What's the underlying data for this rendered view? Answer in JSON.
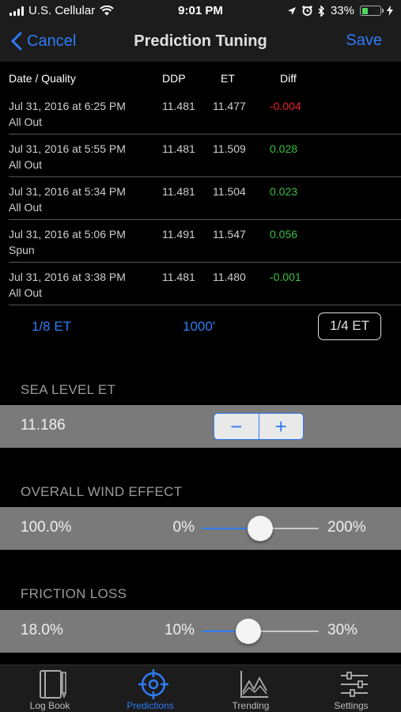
{
  "status_bar": {
    "carrier": "U.S. Cellular",
    "time": "9:01 PM",
    "battery": "33%",
    "battery_level": 0.33,
    "icons": [
      "signal-icon",
      "wifi-icon",
      "location-arrow-icon",
      "alarm-icon",
      "bluetooth-icon",
      "battery-icon",
      "charging-icon"
    ]
  },
  "nav": {
    "back_label": "Cancel",
    "title": "Prediction Tuning",
    "save_label": "Save",
    "accent_color": "#2f7cf6"
  },
  "table": {
    "headers": {
      "date": "Date / Quality",
      "ddp": "DDP",
      "et": "ET",
      "diff": "Diff"
    },
    "rows": [
      {
        "date": "Jul 31, 2016 at 6:25 PM",
        "quality": "All Out",
        "ddp": "11.481",
        "et": "11.477",
        "diff": "-0.004",
        "diff_sign": "neg"
      },
      {
        "date": "Jul 31, 2016 at 5:55 PM",
        "quality": "All Out",
        "ddp": "11.481",
        "et": "11.509",
        "diff": "0.028",
        "diff_sign": "pos"
      },
      {
        "date": "Jul 31, 2016 at 5:34 PM",
        "quality": "All Out",
        "ddp": "11.481",
        "et": "11.504",
        "diff": "0.023",
        "diff_sign": "pos"
      },
      {
        "date": "Jul 31, 2016 at 5:06 PM",
        "quality": "Spun",
        "ddp": "11.491",
        "et": "11.547",
        "diff": "0.056",
        "diff_sign": "pos"
      },
      {
        "date": "Jul 31, 2016 at 3:38 PM",
        "quality": "All Out",
        "ddp": "11.481",
        "et": "11.480",
        "diff": "-0.001",
        "diff_sign": "pos"
      }
    ],
    "negative_color": "#e8242b",
    "positive_color": "#36c13e"
  },
  "distance_selector": {
    "options": [
      "1/8 ET",
      "1000'",
      "1/4 ET"
    ],
    "selected": "1/4 ET"
  },
  "sea_level_et": {
    "header": "SEA LEVEL ET",
    "value": "11.186",
    "minus": "−",
    "plus": "+"
  },
  "wind_effect": {
    "header": "OVERALL WIND EFFECT",
    "value": "100.0%",
    "min_label": "0%",
    "max_label": "200%",
    "level": 0.5
  },
  "friction_loss": {
    "header": "FRICTION LOSS",
    "value": "18.0%",
    "min_label": "10%",
    "max_label": "30%",
    "level": 0.4
  },
  "tab_bar": {
    "tabs": [
      {
        "label": "Log Book",
        "icon": "logbook-icon"
      },
      {
        "label": "Predictions",
        "icon": "crosshair-icon"
      },
      {
        "label": "Trending",
        "icon": "trend-chart-icon"
      },
      {
        "label": "Settings",
        "icon": "sliders-icon"
      }
    ],
    "active": "Predictions"
  }
}
